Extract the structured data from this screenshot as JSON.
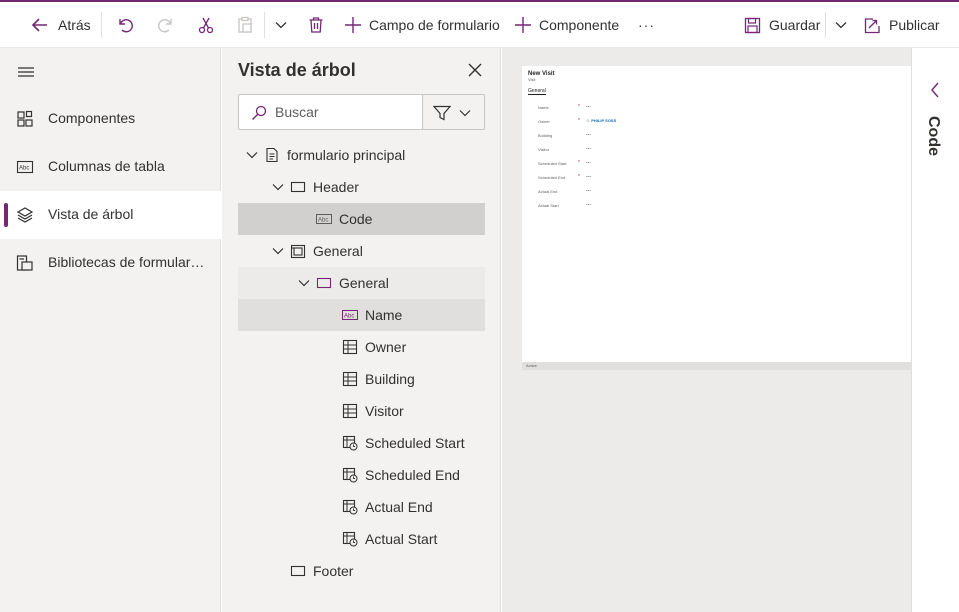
{
  "toolbar": {
    "back_label": "Atrás",
    "add_field_label": "Campo de formulario",
    "add_component_label": "Componente",
    "more_label": "···",
    "save_label": "Guardar",
    "publish_label": "Publicar"
  },
  "leftnav": {
    "items": [
      {
        "label": "Componentes",
        "icon": "components-icon"
      },
      {
        "label": "Columnas de tabla",
        "icon": "table-columns-icon"
      },
      {
        "label": "Vista de árbol",
        "icon": "tree-view-icon",
        "active": true
      },
      {
        "label": "Bibliotecas de formularios",
        "icon": "form-libraries-icon"
      }
    ]
  },
  "tree": {
    "title": "Vista de árbol",
    "search_placeholder": "Buscar",
    "nodes": [
      {
        "label": "formulario principal",
        "type": "form",
        "level": 0,
        "expanded": true
      },
      {
        "label": "Header",
        "type": "section",
        "level": 1,
        "expanded": true
      },
      {
        "label": "Code",
        "type": "text-field",
        "level": 2,
        "selected": true
      },
      {
        "label": "General",
        "type": "tab",
        "level": 1,
        "expanded": true
      },
      {
        "label": "General",
        "type": "section",
        "level": 2,
        "expanded": true
      },
      {
        "label": "Name",
        "type": "text-field",
        "level": 3,
        "hovered": true
      },
      {
        "label": "Owner",
        "type": "lookup-field",
        "level": 3
      },
      {
        "label": "Building",
        "type": "lookup-field",
        "level": 3
      },
      {
        "label": "Visitor",
        "type": "lookup-field",
        "level": 3
      },
      {
        "label": "Scheduled Start",
        "type": "datetime-field",
        "level": 3
      },
      {
        "label": "Scheduled End",
        "type": "datetime-field",
        "level": 3
      },
      {
        "label": "Actual End",
        "type": "datetime-field",
        "level": 3
      },
      {
        "label": "Actual Start",
        "type": "datetime-field",
        "level": 3
      },
      {
        "label": "Footer",
        "type": "section",
        "level": 1
      }
    ]
  },
  "preview": {
    "title": "New Visit",
    "subtitle": "Visit",
    "tab": "General",
    "fields": [
      {
        "label": "Name",
        "required": "*",
        "value": "---"
      },
      {
        "label": "Owner",
        "required": "*",
        "value": "",
        "owner": "PHILIP SOSS"
      },
      {
        "label": "Building",
        "required": "",
        "value": "---"
      },
      {
        "label": "Visitor",
        "required": "",
        "value": "---"
      },
      {
        "label": "Scheduled Start",
        "required": "*",
        "value": "---"
      },
      {
        "label": "Scheduled End",
        "required": "*",
        "value": "---"
      },
      {
        "label": "Actual End",
        "required": "",
        "value": "---"
      },
      {
        "label": "Actual Start",
        "required": "",
        "value": "---"
      }
    ],
    "footer": "Active"
  },
  "right_panel": {
    "label": "Code"
  },
  "colors": {
    "accent": "#742774",
    "panel_bg": "#f3f2f1",
    "selected_bg": "#d2d0ce",
    "canvas_bg": "#edebe9"
  }
}
